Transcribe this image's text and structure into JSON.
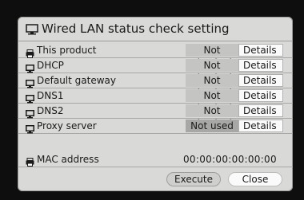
{
  "dialog": {
    "title": "Wired LAN status check setting",
    "title_icon": "monitor-icon"
  },
  "rows": [
    {
      "icon": "printer-icon",
      "label": "This product",
      "status": "Not checked",
      "action": "Details"
    },
    {
      "icon": "monitor-icon",
      "label": "DHCP",
      "status": "Not checked",
      "action": "Details"
    },
    {
      "icon": "monitor-icon",
      "label": "Default gateway",
      "status": "Not checked",
      "action": "Details"
    },
    {
      "icon": "monitor-icon",
      "label": "DNS1",
      "status": "Not checked",
      "action": "Details"
    },
    {
      "icon": "monitor-icon",
      "label": "DNS2",
      "status": "Not checked",
      "action": "Details"
    },
    {
      "icon": "monitor-icon",
      "label": "Proxy server",
      "status": "Not used",
      "action": "Details"
    }
  ],
  "mac": {
    "icon": "printer-icon",
    "label": "MAC address",
    "value": "00:00:00:00:00:00"
  },
  "buttons": {
    "execute": "Execute",
    "close": "Close"
  },
  "colors": {
    "dialog_bg": "#d9d9d7",
    "status_bg": "#c4c4c2",
    "status_not_used_bg": "#a7a7a5",
    "button_bg": "#fafafa",
    "screen_bg": "#0e0e0e"
  }
}
